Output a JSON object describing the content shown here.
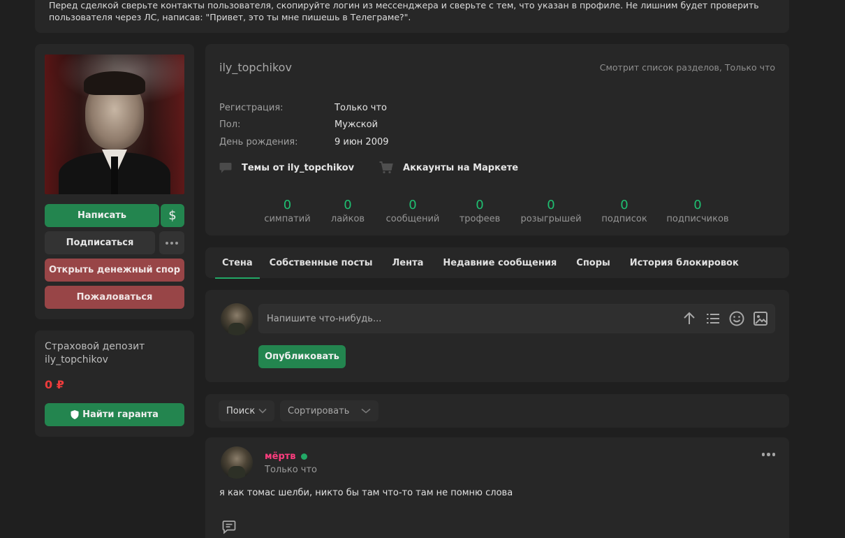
{
  "notice": {
    "line1": "Перед сделкой сверьте контакты пользователя, скопируйте логин из мессенджера и сверьте с тем, что указан в профиле. Не лишним будет проверить",
    "line2": "пользователя через ЛС, написав: \"Привет, это ты мне пишешь в Телеграме?\"."
  },
  "sidebar": {
    "write_label": "Написать",
    "dollar_label": "$",
    "subscribe_label": "Подписаться",
    "dispute_label": "Открыть денежный спор",
    "report_label": "Пожаловаться"
  },
  "insurance": {
    "title_line1": "Страховой депозит",
    "title_line2": "ily_topchikov",
    "amount": "0 ₽",
    "guarantor_label": "Найти гаранта"
  },
  "profile": {
    "username": "ily_topchikov",
    "status": "Смотрит список разделов, Только что",
    "facts": [
      {
        "key": "Регистрация:",
        "value": "Только что"
      },
      {
        "key": "Пол:",
        "value": "Мужской"
      },
      {
        "key": "День рождения:",
        "value": "9 июн 2009"
      }
    ],
    "link_topics": "Темы от ily_topchikov",
    "link_market": "Аккаунты на Маркете",
    "stats": [
      {
        "value": "0",
        "label": "симпатий"
      },
      {
        "value": "0",
        "label": "лайков"
      },
      {
        "value": "0",
        "label": "сообщений"
      },
      {
        "value": "0",
        "label": "трофеев"
      },
      {
        "value": "0",
        "label": "розыгрышей"
      },
      {
        "value": "0",
        "label": "подписок"
      },
      {
        "value": "0",
        "label": "подписчиков"
      }
    ]
  },
  "tabs": [
    "Стена",
    "Собственные посты",
    "Лента",
    "Недавние сообщения",
    "Споры",
    "История блокировок"
  ],
  "composer": {
    "placeholder": "Напишите что-нибудь...",
    "publish_label": "Опубликовать"
  },
  "filters": {
    "search_label": "Поиск",
    "sort_label": "Сортировать"
  },
  "post": {
    "author": "мёртв",
    "time": "Только что",
    "text": "я как томас шелби, никто бы там что-то там не помню слова"
  },
  "colors": {
    "accent_green": "#23854f",
    "stat_green": "#1fbf71",
    "danger_red": "#984547",
    "author_pink": "#ff3d7f",
    "amount_red": "#ec3b3b"
  }
}
